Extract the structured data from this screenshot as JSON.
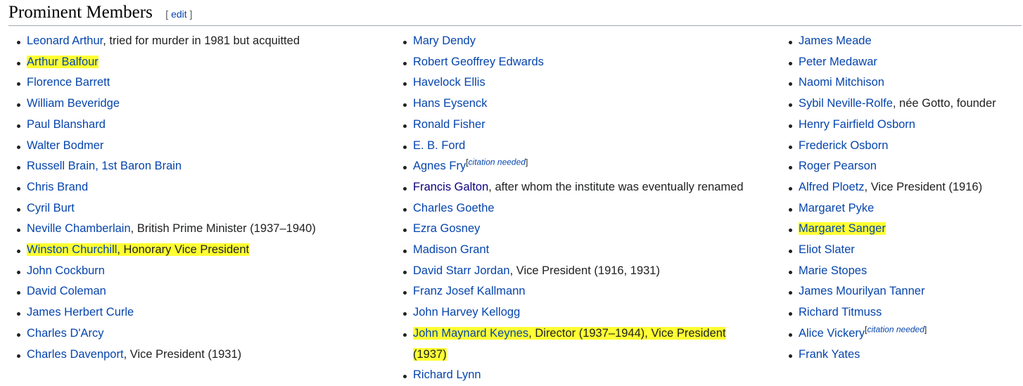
{
  "section": {
    "title": "Prominent Members",
    "edit_open": "[ ",
    "edit_label": "edit",
    "edit_close": " ]"
  },
  "citation_needed": "citation needed",
  "col1": [
    {
      "name": "Leonard Arthur",
      "note": ", tried for murder in 1981 but acquitted"
    },
    {
      "name": "Arthur Balfour",
      "note": "",
      "hl": true
    },
    {
      "name": "Florence Barrett",
      "note": ""
    },
    {
      "name": "William Beveridge",
      "note": ""
    },
    {
      "name": "Paul Blanshard",
      "note": ""
    },
    {
      "name": "Walter Bodmer",
      "note": ""
    },
    {
      "name": "Russell Brain, 1st Baron Brain",
      "note": ""
    },
    {
      "name": "Chris Brand",
      "note": ""
    },
    {
      "name": "Cyril Burt",
      "note": ""
    },
    {
      "name": "Neville Chamberlain",
      "note": ", British Prime Minister (1937–1940)"
    },
    {
      "name": "Winston Churchill",
      "note": ", Honorary Vice President",
      "hl": true
    },
    {
      "name": "John Cockburn",
      "note": ""
    },
    {
      "name": "David Coleman",
      "note": ""
    },
    {
      "name": "James Herbert Curle",
      "note": ""
    },
    {
      "name": "Charles D'Arcy",
      "note": ""
    },
    {
      "name": "Charles Davenport",
      "note": ", Vice President (1931)"
    }
  ],
  "col2": [
    {
      "name": "Mary Dendy",
      "note": ""
    },
    {
      "name": "Robert Geoffrey Edwards",
      "note": ""
    },
    {
      "name": "Havelock Ellis",
      "note": ""
    },
    {
      "name": "Hans Eysenck",
      "note": ""
    },
    {
      "name": "Ronald Fisher",
      "note": ""
    },
    {
      "name": "E. B. Ford",
      "note": ""
    },
    {
      "name": "Agnes Fry",
      "note": "",
      "cite": true
    },
    {
      "name": "Francis Galton",
      "note": ", after whom the institute was eventually renamed",
      "visited": true
    },
    {
      "name": "Charles Goethe",
      "note": ""
    },
    {
      "name": "Ezra Gosney",
      "note": ""
    },
    {
      "name": "Madison Grant",
      "note": ""
    },
    {
      "name": "David Starr Jordan",
      "note": ", Vice President (1916, 1931)"
    },
    {
      "name": "Franz Josef Kallmann",
      "note": ""
    },
    {
      "name": "John Harvey Kellogg",
      "note": ""
    },
    {
      "name": "John Maynard Keynes",
      "note": ", Director (1937–1944), Vice President (1937)",
      "hl": true,
      "wrap": true
    },
    {
      "name": "Richard Lynn",
      "note": ""
    }
  ],
  "col3": [
    {
      "name": "James Meade",
      "note": ""
    },
    {
      "name": "Peter Medawar",
      "note": ""
    },
    {
      "name": "Naomi Mitchison",
      "note": ""
    },
    {
      "name": "Sybil Neville-Rolfe",
      "note": ", née Gotto, founder"
    },
    {
      "name": "Henry Fairfield Osborn",
      "note": ""
    },
    {
      "name": "Frederick Osborn",
      "note": ""
    },
    {
      "name": "Roger Pearson",
      "note": ""
    },
    {
      "name": "Alfred Ploetz",
      "note": ", Vice President (1916)"
    },
    {
      "name": "Margaret Pyke",
      "note": ""
    },
    {
      "name": "Margaret Sanger",
      "note": "",
      "hl": true
    },
    {
      "name": "Eliot Slater",
      "note": ""
    },
    {
      "name": "Marie Stopes",
      "note": ""
    },
    {
      "name": "James Mourilyan Tanner",
      "note": ""
    },
    {
      "name": "Richard Titmuss",
      "note": ""
    },
    {
      "name": "Alice Vickery",
      "note": "",
      "cite": true
    },
    {
      "name": "Frank Yates",
      "note": ""
    }
  ]
}
